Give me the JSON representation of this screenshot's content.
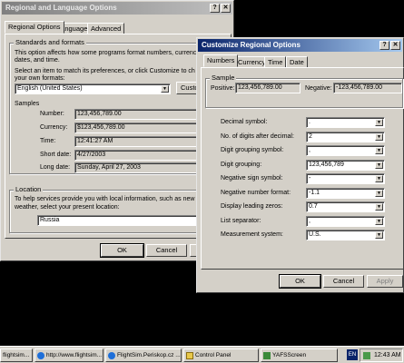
{
  "regional_window": {
    "title": "Regional and Language Options",
    "tabs": [
      "Regional Options",
      "Languages",
      "Advanced"
    ],
    "standards_group_label": "Standards and formats",
    "standards_desc": "This option affects how some programs format numbers, currenc... dates, and time.",
    "standards_desc_line1": "This option affects how some programs format numbers, currenc",
    "standards_desc_line2": "dates, and time.",
    "select_desc_line1": "Select an item to match its preferences, or click Customize to ch",
    "select_desc_line2": "your own formats:",
    "format_value": "English (United States)",
    "customize_label": "Custom",
    "samples_label": "Samples",
    "samples": [
      {
        "label": "Number:",
        "value": "123,456,789.00"
      },
      {
        "label": "Currency:",
        "value": "$123,456,789.00"
      },
      {
        "label": "Time:",
        "value": "12:41:27 AM"
      },
      {
        "label": "Short date:",
        "value": "4/27/2003"
      },
      {
        "label": "Long date:",
        "value": "Sunday, April 27, 2003"
      }
    ],
    "location_group_label": "Location",
    "location_desc_line1": "To help services provide you with local information, such as new",
    "location_desc_line2": "weather, select your present location:",
    "location_value": "Russia",
    "ok_label": "OK",
    "cancel_label": "Cancel"
  },
  "customize_window": {
    "title": "Customize Regional Options",
    "tabs": [
      "Numbers",
      "Currency",
      "Time",
      "Date"
    ],
    "sample_label": "Sample",
    "positive_label": "Positive:",
    "positive_value": "123,456,789.00",
    "negative_label": "Negative:",
    "negative_value": "-123,456,789.00",
    "settings": [
      {
        "label": "Decimal symbol:",
        "value": "."
      },
      {
        "label": "No. of digits after decimal:",
        "value": "2"
      },
      {
        "label": "Digit grouping symbol:",
        "value": ","
      },
      {
        "label": "Digit grouping:",
        "value": "123,456,789"
      },
      {
        "label": "Negative sign symbol:",
        "value": "-"
      },
      {
        "label": "Negative number format:",
        "value": "-1.1"
      },
      {
        "label": "Display leading zeros:",
        "value": "0.7"
      },
      {
        "label": "List separator:",
        "value": ","
      },
      {
        "label": "Measurement system:",
        "value": "U.S."
      }
    ],
    "ok_label": "OK",
    "cancel_label": "Cancel",
    "apply_label": "Apply"
  },
  "taskbar": {
    "tasks": [
      {
        "label": "flightsim...",
        "icon": "ie-icon"
      },
      {
        "label": "http://www.flightsim...",
        "icon": "ie-icon"
      },
      {
        "label": "FlightSim.Periskop.cz ...",
        "icon": "ie-icon"
      },
      {
        "label": "Control Panel",
        "icon": "folder-icon"
      },
      {
        "label": "YAFSScreen",
        "icon": "app-icon"
      }
    ],
    "language": "EN",
    "clock": "12:43 AM"
  }
}
